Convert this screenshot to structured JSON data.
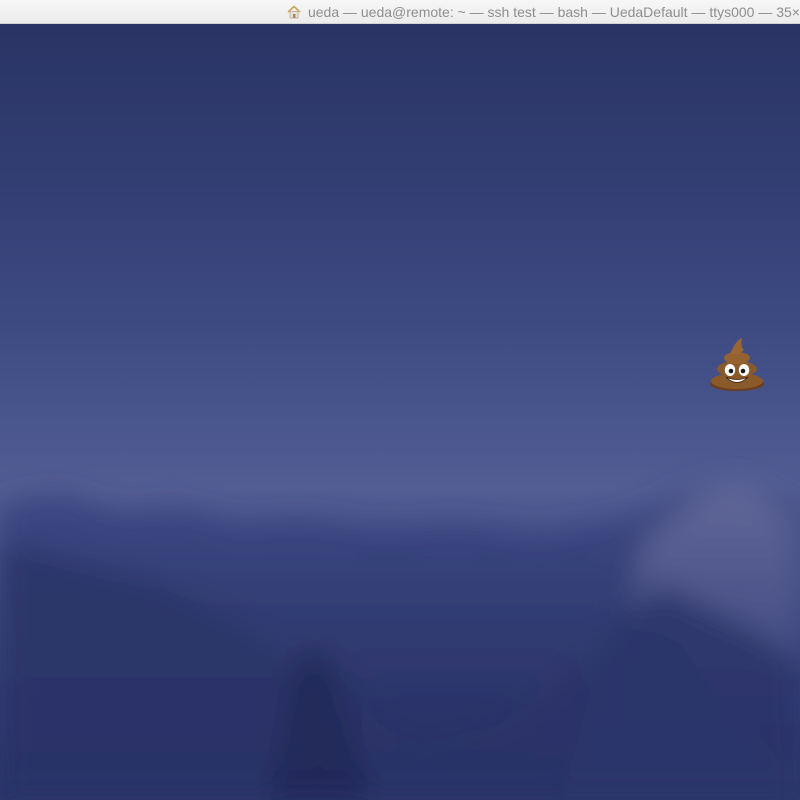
{
  "window": {
    "title": "ueda — ueda@remote: ~ — ssh test — bash — UedaDefault — ttys000 — 35×",
    "home_icon": "home-icon"
  },
  "terminal": {
    "sprite_icon": "pile-of-poo-emoji",
    "colors": {
      "titlebar_text": "#8e8e8e",
      "background_top": "#2a3465",
      "background_mid": "#525d93",
      "mountains": "#2a3468"
    }
  }
}
